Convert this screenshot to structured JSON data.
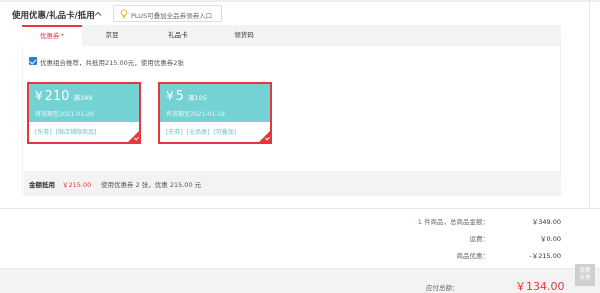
{
  "header": {
    "title": "使用优惠/礼品卡/抵用",
    "plus_label": "PLUS可叠加全品券领券入口"
  },
  "tabs": [
    {
      "label": "优惠券",
      "star": "*"
    },
    {
      "label": "京豆"
    },
    {
      "label": "礼品卡"
    },
    {
      "label": "领货码"
    }
  ],
  "combo": {
    "text": "优惠组合推荐，共抵用215.00元，使用优惠券2张"
  },
  "coupons": [
    {
      "yen": "¥",
      "amount": "210",
      "condition": "满349",
      "expiry": "有效期至2021-01-20",
      "tags": [
        "[东券]",
        "[限店铺限商品]"
      ]
    },
    {
      "yen": "¥",
      "amount": "5",
      "condition": "满105",
      "expiry": "有效期至2021-01-19",
      "tags": [
        "[东券]",
        "[全品类]",
        "[可叠加]"
      ]
    }
  ],
  "summary": {
    "label": "金额抵用",
    "amount": "￥215.00",
    "detail": "使用优惠券 2 张，优惠 215.00 元"
  },
  "totals": {
    "goods_count": "1",
    "goods_label": " 件商品，总商品金额：",
    "goods_value": "￥349.00",
    "shipping_label": "运费：",
    "shipping_value": "￥0.00",
    "discount_label": "商品优惠：",
    "discount_value": "-￥215.00",
    "pay_label": "应付总额：",
    "pay_value": "￥134.00"
  },
  "feedback": {
    "line1": "我要",
    "line2": "反馈"
  },
  "colors": {
    "accent_red": "#e4393c",
    "coupon_teal": "#74d2d4",
    "checkbox_blue": "#2f7bd8"
  }
}
